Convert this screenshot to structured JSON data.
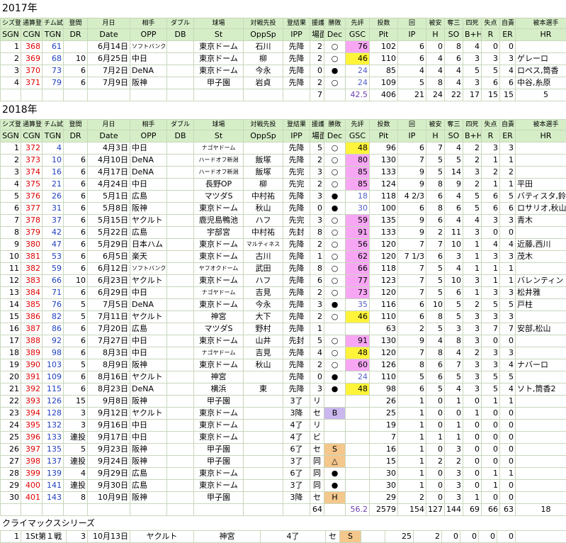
{
  "y2017": {
    "title": "2017年",
    "rows": [
      [
        "1",
        "368",
        "61",
        "",
        "6月14日",
        "ソフトバンク",
        "",
        "東京ドーム",
        "石川",
        "先降",
        "2",
        "○",
        "76",
        "102",
        "6",
        "0",
        "8",
        "4",
        "0",
        "0",
        ""
      ],
      [
        "2",
        "369",
        "68",
        "10",
        "6月25日",
        "中日",
        "",
        "東京ドーム",
        "柳",
        "先降",
        "2",
        "○",
        "46",
        "110",
        "6",
        "4",
        "6",
        "3",
        "3",
        "3",
        "ゲレーロ"
      ],
      [
        "3",
        "370",
        "73",
        "6",
        "7月2日",
        "DeNA",
        "",
        "東京ドーム",
        "今永",
        "先降",
        "0",
        "●",
        "24",
        "85",
        "4",
        "4",
        "4",
        "5",
        "5",
        "4",
        "ロペス,筒香"
      ],
      [
        "4",
        "371",
        "79",
        "6",
        "7月9日",
        "阪神",
        "",
        "甲子園",
        "岩貞",
        "先降",
        "2",
        "○",
        "24",
        "109",
        "5",
        "8",
        "4",
        "3",
        "6",
        "6",
        "中谷,糸原"
      ]
    ],
    "sum": [
      "7",
      "42.5",
      "406",
      "21",
      "24",
      "22",
      "17",
      "15",
      "15",
      "5"
    ]
  },
  "y2018": {
    "title": "2018年",
    "rows": [
      [
        "1",
        "372",
        "4",
        "",
        "4月3日",
        "中日",
        "",
        "ナゴヤドーム",
        "",
        "先降",
        "5",
        "○",
        "48",
        "96",
        "6",
        "7",
        "4",
        "2",
        "3",
        "3",
        ""
      ],
      [
        "2",
        "373",
        "10",
        "6",
        "4月10日",
        "DeNA",
        "",
        "ハードオフ新潟",
        "飯塚",
        "先降",
        "2",
        "○",
        "80",
        "130",
        "7",
        "5",
        "5",
        "2",
        "1",
        "1",
        ""
      ],
      [
        "3",
        "374",
        "16",
        "6",
        "4月17日",
        "DeNA",
        "",
        "ハードオフ新潟",
        "飯塚",
        "先完",
        "3",
        "○",
        "85",
        "133",
        "9",
        "5",
        "14",
        "3",
        "2",
        "2",
        ""
      ],
      [
        "4",
        "375",
        "21",
        "6",
        "4月24日",
        "中日",
        "",
        "長野OP",
        "柳",
        "先完",
        "2",
        "○",
        "85",
        "124",
        "9",
        "8",
        "9",
        "2",
        "1",
        "1",
        "平田"
      ],
      [
        "5",
        "376",
        "26",
        "6",
        "5月1日",
        "広島",
        "",
        "マツダS",
        "中村祐",
        "先降",
        "3",
        "●",
        "18",
        "118",
        "4 2/3",
        "6",
        "4",
        "5",
        "6",
        "5",
        "バティスタ,鈴木"
      ],
      [
        "6",
        "377",
        "31",
        "6",
        "5月8日",
        "阪神",
        "",
        "東京ドーム",
        "秋山",
        "先降",
        "0",
        "●",
        "30",
        "100",
        "6",
        "8",
        "6",
        "5",
        "6",
        "6",
        "ロサリオ,秋山"
      ],
      [
        "7",
        "378",
        "37",
        "6",
        "5月15日",
        "ヤクルト",
        "",
        "鹿児島鴨池",
        "ハフ",
        "先完",
        "3",
        "○",
        "59",
        "135",
        "9",
        "6",
        "4",
        "4",
        "3",
        "3",
        "青木"
      ],
      [
        "8",
        "379",
        "42",
        "6",
        "5月22日",
        "広島",
        "",
        "宇部宮",
        "中村祐",
        "先封",
        "8",
        "○",
        "91",
        "133",
        "9",
        "2",
        "11",
        "3",
        "0",
        "0",
        ""
      ],
      [
        "9",
        "380",
        "47",
        "6",
        "5月29日",
        "日本ハム",
        "",
        "東京ドーム",
        "マルティネス",
        "先降",
        "2",
        "○",
        "56",
        "120",
        "7",
        "7",
        "10",
        "1",
        "4",
        "4",
        "近藤,西川"
      ],
      [
        "10",
        "381",
        "53",
        "6",
        "6月5日",
        "楽天",
        "",
        "東京ドーム",
        "古川",
        "先降",
        "1",
        "○",
        "62",
        "120",
        "7 1/3",
        "6",
        "3",
        "1",
        "3",
        "3",
        "茂木"
      ],
      [
        "11",
        "382",
        "59",
        "6",
        "6月12日",
        "ソフトバンク",
        "",
        "ヤフオクドーム",
        "武田",
        "先降",
        "8",
        "○",
        "66",
        "118",
        "7",
        "5",
        "4",
        "1",
        "1",
        "1",
        ""
      ],
      [
        "12",
        "383",
        "66",
        "10",
        "6月23日",
        "ヤクルト",
        "",
        "東京ドーム",
        "ハフ",
        "先降",
        "6",
        "○",
        "77",
        "123",
        "7",
        "5",
        "10",
        "3",
        "1",
        "1",
        "バレンティン"
      ],
      [
        "13",
        "384",
        "71",
        "6",
        "6月29日",
        "中日",
        "",
        "ナゴヤドーム",
        "吉見",
        "先降",
        "2",
        "○",
        "73",
        "120",
        "7",
        "5",
        "6",
        "1",
        "3",
        "3",
        "松井雅"
      ],
      [
        "14",
        "385",
        "76",
        "5",
        "7月5日",
        "DeNA",
        "",
        "東京ドーム",
        "今永",
        "先降",
        "3",
        "●",
        "35",
        "116",
        "6",
        "10",
        "5",
        "2",
        "5",
        "5",
        "戸柱"
      ],
      [
        "15",
        "386",
        "82",
        "5",
        "7月11日",
        "ヤクルト",
        "",
        "神宮",
        "大下",
        "先降",
        "2",
        "○",
        "46",
        "110",
        "6",
        "8",
        "5",
        "3",
        "3",
        "3",
        ""
      ],
      [
        "16",
        "387",
        "86",
        "6",
        "7月20日",
        "広島",
        "",
        "マツダS",
        "野村",
        "先降",
        "1",
        "",
        "",
        "63",
        "2",
        "5",
        "3",
        "3",
        "7",
        "7",
        "安部,松山"
      ],
      [
        "17",
        "388",
        "92",
        "6",
        "7月27日",
        "中日",
        "",
        "東京ドーム",
        "山井",
        "先封",
        "5",
        "○",
        "91",
        "130",
        "9",
        "4",
        "8",
        "3",
        "0",
        "0",
        ""
      ],
      [
        "18",
        "389",
        "98",
        "6",
        "8月3日",
        "中日",
        "",
        "ナゴヤドーム",
        "吉見",
        "先降",
        "4",
        "○",
        "48",
        "120",
        "7",
        "8",
        "4",
        "2",
        "3",
        "3",
        ""
      ],
      [
        "19",
        "390",
        "103",
        "5",
        "8月9日",
        "阪神",
        "",
        "東京ドーム",
        "秋山",
        "先降",
        "2",
        "○",
        "60",
        "126",
        "8",
        "6",
        "7",
        "3",
        "3",
        "4",
        "ナバーロ"
      ],
      [
        "20",
        "391",
        "109",
        "6",
        "8月16日",
        "ヤクルト",
        "",
        "神宮",
        "",
        "先降",
        "0",
        "●",
        "24",
        "110",
        "5",
        "6",
        "5",
        "3",
        "5",
        "5",
        ""
      ],
      [
        "21",
        "392",
        "115",
        "6",
        "8月23日",
        "DeNA",
        "",
        "横浜",
        "東",
        "先降",
        "3",
        "●",
        "48",
        "98",
        "6",
        "5",
        "4",
        "3",
        "5",
        "4",
        "ソト,筒香2"
      ],
      [
        "22",
        "393",
        "126",
        "15",
        "9月8日",
        "阪神",
        "",
        "甲子園",
        "",
        "3了",
        "リ",
        "",
        "",
        "26",
        "1",
        "0",
        "1",
        "0",
        "1",
        "1",
        ""
      ],
      [
        "23",
        "394",
        "128",
        "3",
        "9月12日",
        "ヤクルト",
        "",
        "東京ドーム",
        "",
        "3降",
        "セ",
        "B",
        "",
        "25",
        "1",
        "0",
        "0",
        "1",
        "0",
        "0",
        ""
      ],
      [
        "24",
        "395",
        "132",
        "3",
        "9月16日",
        "中日",
        "",
        "東京ドーム",
        "",
        "4了",
        "リ",
        "",
        "",
        "19",
        "1",
        "0",
        "1",
        "0",
        "0",
        "0",
        ""
      ],
      [
        "25",
        "396",
        "133",
        "連投",
        "9月17日",
        "中日",
        "",
        "東京ドーム",
        "",
        "4了",
        "ビ",
        "",
        "",
        "7",
        "1",
        "1",
        "1",
        "0",
        "0",
        "0",
        ""
      ],
      [
        "26",
        "397",
        "135",
        "5",
        "9月23日",
        "阪神",
        "",
        "甲子園",
        "",
        "6了",
        "セ",
        "S",
        "",
        "16",
        "1",
        "0",
        "3",
        "0",
        "0",
        "0",
        ""
      ],
      [
        "27",
        "398",
        "137",
        "連投",
        "9月24日",
        "阪神",
        "",
        "甲子園",
        "",
        "3了",
        "同",
        "△",
        "",
        "15",
        "1",
        "2",
        "2",
        "0",
        "0",
        "0",
        ""
      ],
      [
        "28",
        "399",
        "139",
        "4",
        "9月29日",
        "広島",
        "",
        "東京ドーム",
        "",
        "6了",
        "同",
        "●",
        "",
        "30",
        "1",
        "0",
        "3",
        "0",
        "1",
        "1",
        ""
      ],
      [
        "29",
        "400",
        "141",
        "連投",
        "9月30日",
        "広島",
        "",
        "東京ドーム",
        "",
        "3了",
        "同",
        "●",
        "",
        "30",
        "1",
        "0",
        "3",
        "0",
        "1",
        "0",
        ""
      ],
      [
        "30",
        "401",
        "143",
        "8",
        "10月9日",
        "阪神",
        "",
        "甲子園",
        "",
        "3降",
        "セ",
        "H",
        "",
        "29",
        "2",
        "0",
        "3",
        "1",
        "0",
        "0",
        ""
      ]
    ],
    "sum": [
      "64",
      "56.2",
      "2579",
      "154",
      "127",
      "144",
      "69",
      "66",
      "63",
      "18"
    ]
  },
  "header": {
    "top": [
      "シズ登",
      "通算登",
      "チム試",
      "登間",
      "月日",
      "相手",
      "ダブル",
      "球場",
      "対戦先投",
      "登結果",
      "援護",
      "勝敗",
      "先評",
      "投数",
      "回",
      "被安",
      "奪三",
      "四死",
      "失点",
      "自責",
      "被本選手"
    ],
    "bottom": [
      "SGN",
      "CGN",
      "TGN",
      "DR",
      "Date",
      "OPP",
      "DB",
      "St",
      "OppSp",
      "IPP",
      "場面",
      "Dec",
      "GSC",
      "Pit",
      "IP",
      "H",
      "SO",
      "B+H",
      "R",
      "ER",
      "HR"
    ]
  },
  "cs": {
    "title": "クライマックスシリーズ",
    "row": [
      "1",
      "1St第１戦",
      "3",
      "10月13日",
      "ヤクルト",
      "神宮",
      "4了",
      "セ",
      "S",
      "",
      "25",
      "2",
      "0",
      "0",
      "0",
      "0",
      ""
    ]
  }
}
